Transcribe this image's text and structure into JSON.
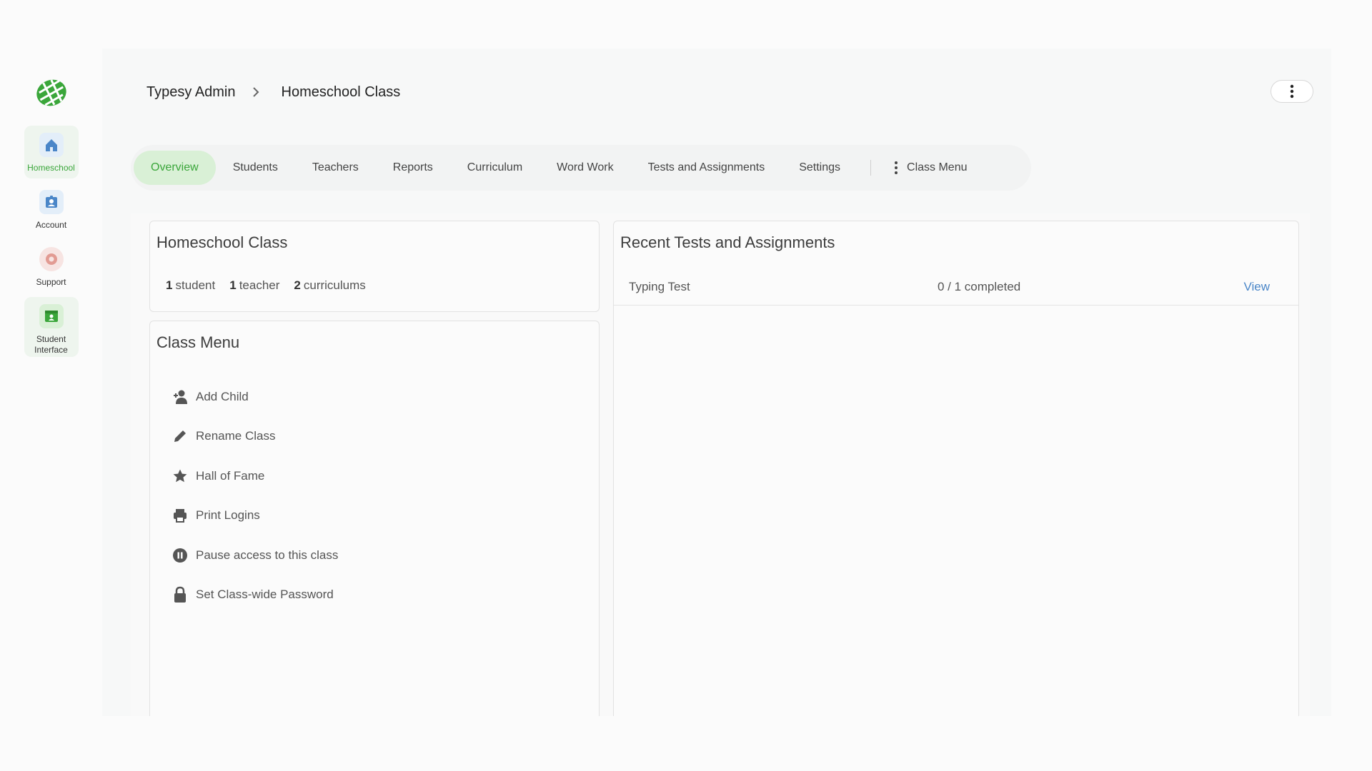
{
  "sidebar": {
    "items": [
      {
        "label": "Homeschool",
        "icon": "home-icon"
      },
      {
        "label": "Account",
        "icon": "account-icon"
      },
      {
        "label": "Support",
        "icon": "support-icon"
      },
      {
        "label": "Student Interface",
        "icon": "student-interface-icon"
      }
    ]
  },
  "header": {
    "breadcrumb": [
      "Typesy Admin",
      "Homeschool Class"
    ]
  },
  "tabs": {
    "items": [
      "Overview",
      "Students",
      "Teachers",
      "Reports",
      "Curriculum",
      "Word Work",
      "Tests and Assignments",
      "Settings"
    ],
    "active": "Overview",
    "class_menu": "Class Menu"
  },
  "class_card": {
    "title": "Homeschool Class",
    "stats": [
      {
        "count": "1",
        "label": "student"
      },
      {
        "count": "1",
        "label": "teacher"
      },
      {
        "count": "2",
        "label": "curriculums"
      }
    ]
  },
  "class_menu": {
    "title": "Class Menu",
    "items": [
      {
        "label": "Add Child",
        "icon": "add-user-icon"
      },
      {
        "label": "Rename Class",
        "icon": "pencil-icon"
      },
      {
        "label": "Hall of Fame",
        "icon": "star-icon"
      },
      {
        "label": "Print Logins",
        "icon": "printer-icon"
      },
      {
        "label": "Pause access to this class",
        "icon": "pause-icon"
      },
      {
        "label": "Set Class-wide Password",
        "icon": "lock-icon"
      }
    ]
  },
  "recent": {
    "title": "Recent Tests and Assignments",
    "rows": [
      {
        "name": "Typing Test",
        "progress": "0 / 1 completed",
        "action": "View"
      }
    ]
  },
  "colors": {
    "accent_green": "#3aa63a",
    "active_tab_bg": "#d9f0d6",
    "link_blue": "#4a86c8"
  }
}
